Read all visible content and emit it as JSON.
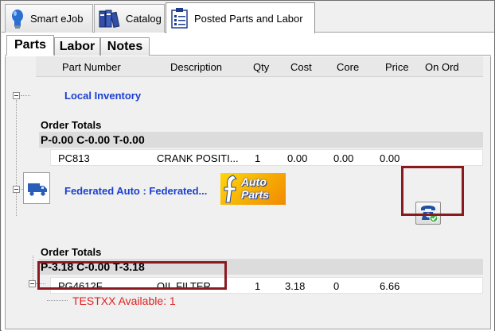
{
  "tabs": [
    {
      "label": "Smart eJob",
      "icon": "lightbulb-icon"
    },
    {
      "label": "Catalog",
      "icon": "catalog-books-icon"
    },
    {
      "label": "Posted Parts and Labor",
      "icon": "clipboard-icon"
    }
  ],
  "sub_tabs": [
    "Parts",
    "Labor",
    "Notes"
  ],
  "columns": [
    "Part Number",
    "Description",
    "Qty",
    "Cost",
    "Core",
    "Price",
    "On Ord"
  ],
  "groups": [
    {
      "title": "Local Inventory",
      "totals_label": "Order Totals",
      "totals": "P-0.00  C-0.00  T-0.00",
      "parts": [
        {
          "part_number": "PC813",
          "description": "CRANK POSITI...",
          "qty": "1",
          "cost": "0.00",
          "core": "0.00",
          "price": "0.00"
        }
      ]
    },
    {
      "title": "Federated Auto : Federated...",
      "logo": {
        "line1": "Auto",
        "line2": "Parts"
      },
      "totals_label": "Order Totals",
      "totals": "P-3.18  C-0.00  T-3.18",
      "parts": [
        {
          "part_number": "PG4612F",
          "description": "OIL FILTER",
          "qty": "1",
          "cost": "3.18",
          "core": "0",
          "price": "6.66"
        }
      ],
      "availability": "TESTXX Available: 1"
    }
  ],
  "colors": {
    "accent": "#1a3fcf",
    "highlight_box": "#8b1a1f",
    "availability_text": "#e02020"
  }
}
